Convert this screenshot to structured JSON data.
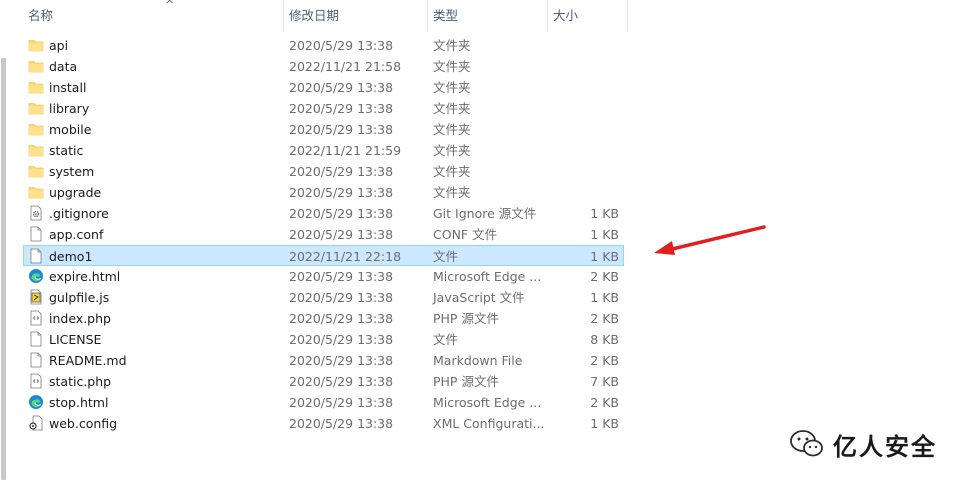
{
  "columns": {
    "name": "名称",
    "date": "修改日期",
    "type": "类型",
    "size": "大小"
  },
  "sort_indicator": "^",
  "files": [
    {
      "name": "api",
      "date": "2020/5/29 13:38",
      "type": "文件夹",
      "size": "",
      "icon": "folder-icon"
    },
    {
      "name": "data",
      "date": "2022/11/21 21:58",
      "type": "文件夹",
      "size": "",
      "icon": "folder-icon"
    },
    {
      "name": "install",
      "date": "2020/5/29 13:38",
      "type": "文件夹",
      "size": "",
      "icon": "folder-icon"
    },
    {
      "name": "library",
      "date": "2020/5/29 13:38",
      "type": "文件夹",
      "size": "",
      "icon": "folder-icon"
    },
    {
      "name": "mobile",
      "date": "2020/5/29 13:38",
      "type": "文件夹",
      "size": "",
      "icon": "folder-icon"
    },
    {
      "name": "static",
      "date": "2022/11/21 21:59",
      "type": "文件夹",
      "size": "",
      "icon": "folder-icon"
    },
    {
      "name": "system",
      "date": "2020/5/29 13:38",
      "type": "文件夹",
      "size": "",
      "icon": "folder-icon"
    },
    {
      "name": "upgrade",
      "date": "2020/5/29 13:38",
      "type": "文件夹",
      "size": "",
      "icon": "folder-icon"
    },
    {
      "name": ".gitignore",
      "date": "2020/5/29 13:38",
      "type": "Git Ignore 源文件",
      "size": "1 KB",
      "icon": "gear-file-icon"
    },
    {
      "name": "app.conf",
      "date": "2020/5/29 13:38",
      "type": "CONF 文件",
      "size": "1 KB",
      "icon": "blank-file-icon"
    },
    {
      "name": "demo1",
      "date": "2022/11/21 22:18",
      "type": "文件",
      "size": "1 KB",
      "icon": "blank-file-icon",
      "selected": true
    },
    {
      "name": "expire.html",
      "date": "2020/5/29 13:38",
      "type": "Microsoft Edge ...",
      "size": "2 KB",
      "icon": "edge-icon"
    },
    {
      "name": "gulpfile.js",
      "date": "2020/5/29 13:38",
      "type": "JavaScript 文件",
      "size": "1 KB",
      "icon": "js-file-icon"
    },
    {
      "name": "index.php",
      "date": "2020/5/29 13:38",
      "type": "PHP 源文件",
      "size": "2 KB",
      "icon": "php-file-icon"
    },
    {
      "name": "LICENSE",
      "date": "2020/5/29 13:38",
      "type": "文件",
      "size": "8 KB",
      "icon": "blank-file-icon"
    },
    {
      "name": "README.md",
      "date": "2020/5/29 13:38",
      "type": "Markdown File",
      "size": "2 KB",
      "icon": "blank-file-icon"
    },
    {
      "name": "static.php",
      "date": "2020/5/29 13:38",
      "type": "PHP 源文件",
      "size": "7 KB",
      "icon": "php-file-icon"
    },
    {
      "name": "stop.html",
      "date": "2020/5/29 13:38",
      "type": "Microsoft Edge ...",
      "size": "2 KB",
      "icon": "edge-icon"
    },
    {
      "name": "web.config",
      "date": "2020/5/29 13:38",
      "type": "XML Configurati...",
      "size": "1 KB",
      "icon": "config-file-icon"
    }
  ],
  "watermark": {
    "text": "亿人安全",
    "icon": "wechat-icon"
  },
  "colors": {
    "selection_bg": "#cce8ff",
    "selection_border": "#99d1ff",
    "folder": "#ffd766",
    "arrow": "#e02020"
  }
}
